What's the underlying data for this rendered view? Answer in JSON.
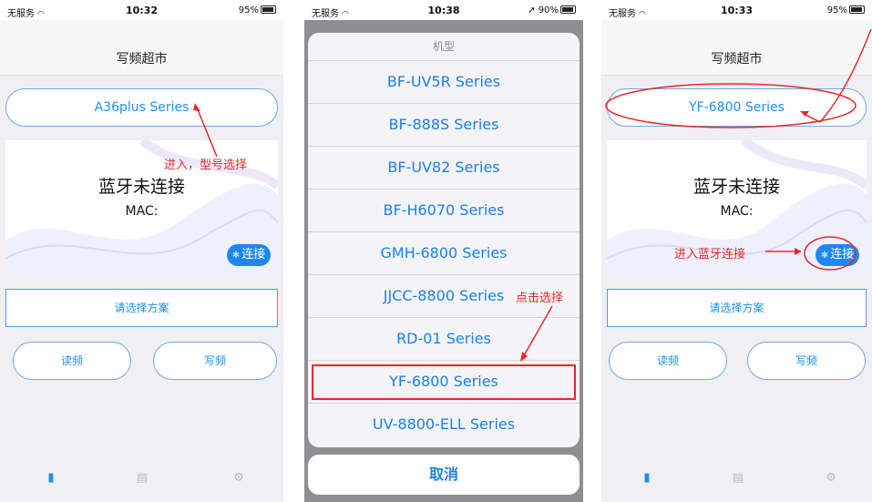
{
  "left": {
    "status": {
      "carrier": "无服务",
      "time": "10:32",
      "battery": "95%"
    },
    "title": "写频超市",
    "model_button": "A36plus Series",
    "bluetooth_status": "蓝牙未连接",
    "mac_label": "MAC:",
    "connect_button": "连接",
    "scheme_button": "请选择方案",
    "read_button": "读频",
    "write_button": "写频",
    "annotation": "进入，型号选择"
  },
  "middle": {
    "status": {
      "carrier": "无服务",
      "time": "10:38",
      "battery": "90%"
    },
    "sheet_title": "机型",
    "options": [
      "BF-UV5R Series",
      "BF-888S Series",
      "BF-UV82 Series",
      "BF-H6070 Series",
      "GMH-6800 Series",
      "JJCC-8800 Series",
      "RD-01 Series",
      "YF-6800 Series",
      "UV-8800-ELL Series"
    ],
    "selected_option": "YF-6800 Series",
    "cancel_button": "取消",
    "annotation": "点击选择"
  },
  "right": {
    "status": {
      "carrier": "无服务",
      "time": "10:33",
      "battery": "95%"
    },
    "title": "写频超市",
    "model_button": "YF-6800 Series",
    "bluetooth_status": "蓝牙未连接",
    "mac_label": "MAC:",
    "connect_button": "连接",
    "scheme_button": "请选择方案",
    "read_button": "读频",
    "write_button": "写频",
    "annotation": "进入蓝牙连接"
  },
  "icons": {
    "tab_home": "radio-icon",
    "tab_doc": "document-icon",
    "tab_settings": "gear-icon",
    "bluetooth": "bluetooth-icon"
  },
  "colors": {
    "accent": "#1c8ef1",
    "connect": "#1f87ee",
    "annotation": "#e8282c"
  }
}
